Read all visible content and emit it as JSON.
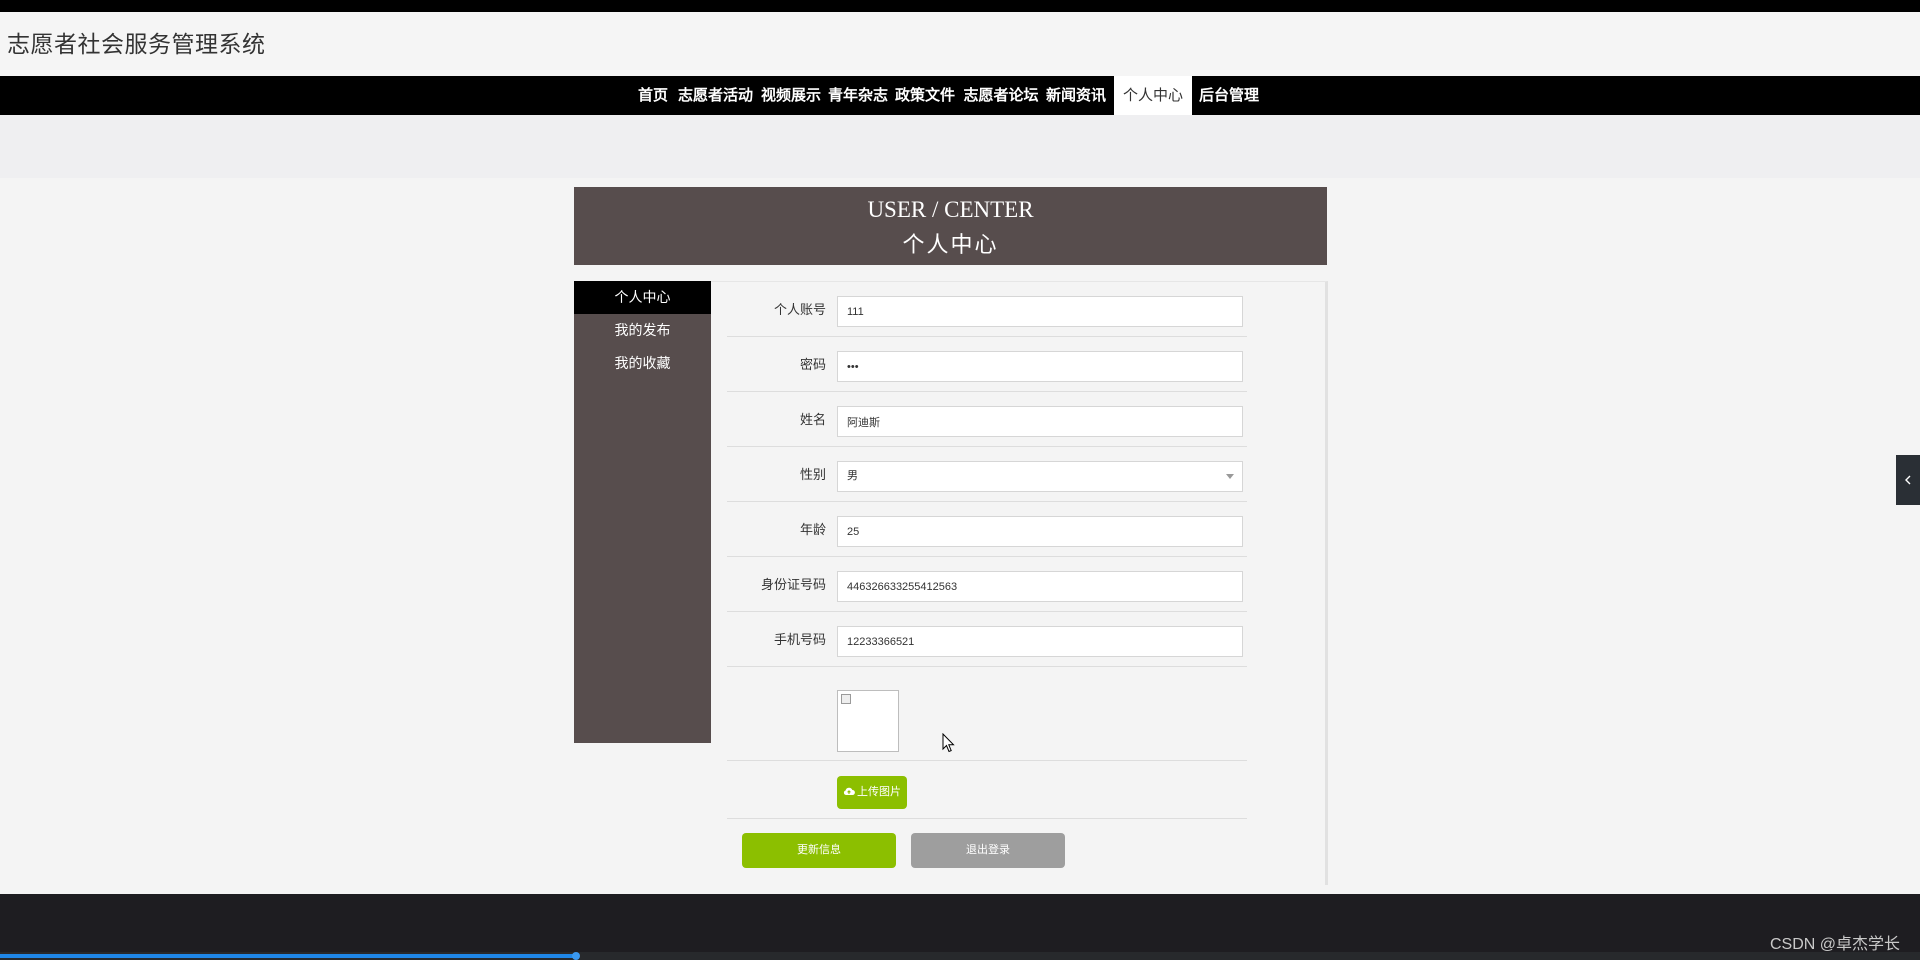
{
  "header": {
    "site_title": "志愿者社会服务管理系统"
  },
  "nav": {
    "items": [
      "首页",
      "志愿者活动",
      "视频展示",
      "青年杂志",
      "政策文件",
      "志愿者论坛",
      "新闻资讯",
      "个人中心",
      "后台管理"
    ],
    "active": "个人中心"
  },
  "page_head": {
    "en": "USER / CENTER",
    "zh": "个人中心"
  },
  "side_menu": {
    "items": [
      "个人中心",
      "我的发布",
      "我的收藏"
    ],
    "active": "个人中心"
  },
  "form": {
    "account": {
      "label": "个人账号",
      "value": "111"
    },
    "password": {
      "label": "密码",
      "value": "•••"
    },
    "name": {
      "label": "姓名",
      "value": "阿迪斯"
    },
    "gender": {
      "label": "性别",
      "value": "男"
    },
    "age": {
      "label": "年龄",
      "value": "25"
    },
    "id_card": {
      "label": "身份证号码",
      "value": "446326633255412563"
    },
    "phone": {
      "label": "手机号码",
      "value": "12233366521"
    }
  },
  "buttons": {
    "upload": "上传图片",
    "update": "更新信息",
    "logout": "退出登录"
  },
  "watermark": "CSDN @卓杰学长",
  "icons": {
    "upload": "cloud-upload-icon",
    "toggle": "chevron-left-icon",
    "caret": "chevron-down-icon",
    "cursor": "mouse-cursor-icon"
  },
  "colors": {
    "accent_green": "#8cbf00",
    "header_brown": "#574d4d",
    "nav_black": "#000000",
    "progress_blue": "#1f87e8"
  },
  "video_progress_percent": 30
}
